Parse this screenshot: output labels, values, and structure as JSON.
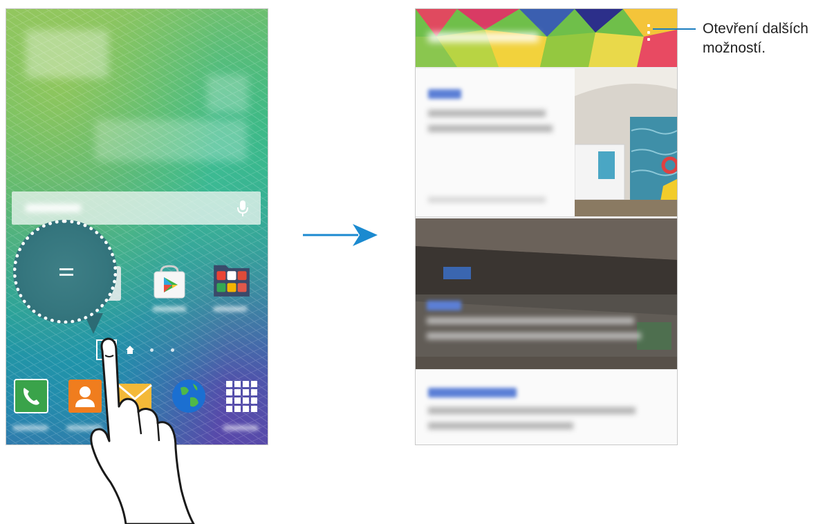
{
  "home_screen": {
    "wallpaper": "green-blue frosted texture",
    "search": {
      "mic_icon": "microphone-icon"
    },
    "apps": [
      {
        "name": "play-store-icon"
      },
      {
        "name": "apps-folder-icon"
      }
    ],
    "page_indicator": {
      "briefing_icon": "briefing-page-icon",
      "home_icon": "home-icon",
      "dots": 2
    },
    "dock": [
      {
        "icon": "phone-icon",
        "color": "#3aa34a"
      },
      {
        "icon": "contacts-icon",
        "color": "#f07d1e"
      },
      {
        "icon": "messages-icon",
        "color": "#f4b938"
      },
      {
        "icon": "internet-icon",
        "color": "#1b6fd1"
      },
      {
        "icon": "apps-grid-icon",
        "color": "#ffffff"
      }
    ]
  },
  "arrow": {
    "color": "#1b8ad0"
  },
  "briefing": {
    "header_icon": "more-options-icon",
    "accent": "#5b7fd6"
  },
  "callout": {
    "text": "Otevření dalších možností.",
    "line_color": "#1b7ec0"
  }
}
